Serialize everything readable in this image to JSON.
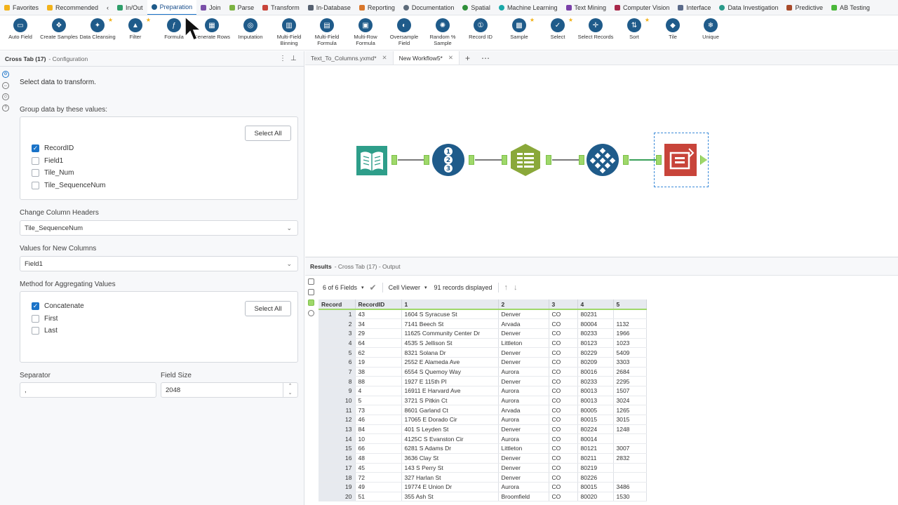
{
  "categories": [
    {
      "label": "Favorites",
      "color": "#f2b21a",
      "icon": "star-icon"
    },
    {
      "label": "Recommended",
      "color": "#f2b21a",
      "icon": "lightbulb-icon"
    },
    {
      "label": "In/Out",
      "color": "#2e9e6a",
      "icon": "book-icon"
    },
    {
      "label": "Preparation",
      "color": "#1f5b8a",
      "icon": "circle-icon",
      "active": true
    },
    {
      "label": "Join",
      "color": "#7a4fa8",
      "icon": "square-icon"
    },
    {
      "label": "Parse",
      "color": "#7cb342",
      "icon": "hexagon-icon"
    },
    {
      "label": "Transform",
      "color": "#c8443a",
      "icon": "square-icon"
    },
    {
      "label": "In-Database",
      "color": "#556070",
      "icon": "database-icon"
    },
    {
      "label": "Reporting",
      "color": "#d9772b",
      "icon": "tag-icon"
    },
    {
      "label": "Documentation",
      "color": "#5d6b7a",
      "icon": "cloud-icon"
    },
    {
      "label": "Spatial",
      "color": "#2f8f3a",
      "icon": "globe-icon"
    },
    {
      "label": "Machine Learning",
      "color": "#1aa8a8",
      "icon": "circle-icon"
    },
    {
      "label": "Text Mining",
      "color": "#7a3fa8",
      "icon": "square-icon"
    },
    {
      "label": "Computer Vision",
      "color": "#a8284a",
      "icon": "square-icon"
    },
    {
      "label": "Interface",
      "color": "#5a6a8a",
      "icon": "diamond-icon"
    },
    {
      "label": "Data Investigation",
      "color": "#2a9a8a",
      "icon": "circle-icon"
    },
    {
      "label": "Predictive",
      "color": "#a84a2a",
      "icon": "square-icon"
    },
    {
      "label": "AB Testing",
      "color": "#4ab83a",
      "icon": "square-icon"
    }
  ],
  "tools": [
    {
      "label": "Auto Field",
      "star": false
    },
    {
      "label": "Create Samples",
      "star": false
    },
    {
      "label": "Data Cleansing",
      "star": true
    },
    {
      "label": "Filter",
      "star": true
    },
    {
      "label": "Formula",
      "star": false
    },
    {
      "label": "Generate Rows",
      "star": false
    },
    {
      "label": "Imputation",
      "star": false
    },
    {
      "label": "Multi-Field Binning",
      "star": false
    },
    {
      "label": "Multi-Field Formula",
      "star": false
    },
    {
      "label": "Multi-Row Formula",
      "star": false
    },
    {
      "label": "Oversample Field",
      "star": false
    },
    {
      "label": "Random % Sample",
      "star": false
    },
    {
      "label": "Record ID",
      "star": false
    },
    {
      "label": "Sample",
      "star": true
    },
    {
      "label": "Select",
      "star": true
    },
    {
      "label": "Select Records",
      "star": false
    },
    {
      "label": "Sort",
      "star": true
    },
    {
      "label": "Tile",
      "star": false
    },
    {
      "label": "Unique",
      "star": false
    }
  ],
  "config": {
    "title": "Cross Tab (17)",
    "subtitle": "- Configuration",
    "intro": "Select data to transform.",
    "group_label": "Group data by these values:",
    "select_all": "Select All",
    "group_fields": [
      {
        "label": "RecordID",
        "checked": true
      },
      {
        "label": "Field1",
        "checked": false
      },
      {
        "label": "Tile_Num",
        "checked": false
      },
      {
        "label": "Tile_SequenceNum",
        "checked": false
      }
    ],
    "headers_label": "Change Column Headers",
    "headers_value": "Tile_SequenceNum",
    "values_label": "Values for New Columns",
    "values_value": "Field1",
    "method_label": "Method for Aggregating Values",
    "methods": [
      {
        "label": "Concatenate",
        "checked": true
      },
      {
        "label": "First",
        "checked": false
      },
      {
        "label": "Last",
        "checked": false
      }
    ],
    "separator_label": "Separator",
    "separator_value": ",",
    "fieldsize_label": "Field Size",
    "fieldsize_value": "2048"
  },
  "doc_tabs": [
    {
      "label": "Text_To_Columns.yxmd*",
      "active": false
    },
    {
      "label": "New Workflow5*",
      "active": true
    }
  ],
  "results": {
    "title": "Results",
    "subtitle": "- Cross Tab (17) - Output",
    "fields": "6 of 6 Fields",
    "viewer": "Cell Viewer",
    "records": "91 records displayed",
    "columns": [
      "Record",
      "RecordID",
      "1",
      "2",
      "3",
      "4",
      "5"
    ],
    "rows": [
      [
        "1",
        "43",
        "1604 S Syracuse St",
        "Denver",
        "CO",
        "80231",
        ""
      ],
      [
        "2",
        "34",
        "7141 Beech St",
        "Arvada",
        "CO",
        "80004",
        "1132"
      ],
      [
        "3",
        "29",
        "11625 Community Center Dr",
        "Denver",
        "CO",
        "80233",
        "1966"
      ],
      [
        "4",
        "64",
        "4535 S Jellison St",
        "Littleton",
        "CO",
        "80123",
        "1023"
      ],
      [
        "5",
        "62",
        "8321 Solana Dr",
        "Denver",
        "CO",
        "80229",
        "5409"
      ],
      [
        "6",
        "19",
        "2552 E Alameda Ave",
        "Denver",
        "CO",
        "80209",
        "3303"
      ],
      [
        "7",
        "38",
        "6554 S Quemoy Way",
        "Aurora",
        "CO",
        "80016",
        "2684"
      ],
      [
        "8",
        "88",
        "1927 E 115th Pl",
        "Denver",
        "CO",
        "80233",
        "2295"
      ],
      [
        "9",
        "4",
        "16911 E Harvard Ave",
        "Aurora",
        "CO",
        "80013",
        "1507"
      ],
      [
        "10",
        "5",
        "3721 S Pitkin Ct",
        "Aurora",
        "CO",
        "80013",
        "3024"
      ],
      [
        "11",
        "73",
        "8601 Garland Ct",
        "Arvada",
        "CO",
        "80005",
        "1265"
      ],
      [
        "12",
        "46",
        "17065 E Dorado Cir",
        "Aurora",
        "CO",
        "80015",
        "3015"
      ],
      [
        "13",
        "84",
        "401 S Leyden St",
        "Denver",
        "CO",
        "80224",
        "1248"
      ],
      [
        "14",
        "10",
        "4125C S Evanston Cir",
        "Aurora",
        "CO",
        "80014",
        ""
      ],
      [
        "15",
        "66",
        "6281 S Adams Dr",
        "Littleton",
        "CO",
        "80121",
        "3007"
      ],
      [
        "16",
        "48",
        "3636 Clay St",
        "Denver",
        "CO",
        "80211",
        "2832"
      ],
      [
        "17",
        "45",
        "143 S Perry St",
        "Denver",
        "CO",
        "80219",
        ""
      ],
      [
        "18",
        "72",
        "327 Harlan St",
        "Denver",
        "CO",
        "80226",
        ""
      ],
      [
        "19",
        "49",
        "19774 E Union Dr",
        "Aurora",
        "CO",
        "80015",
        "3486"
      ],
      [
        "20",
        "51",
        "355 Ash St",
        "Broomfield",
        "CO",
        "80020",
        "1530"
      ]
    ]
  }
}
